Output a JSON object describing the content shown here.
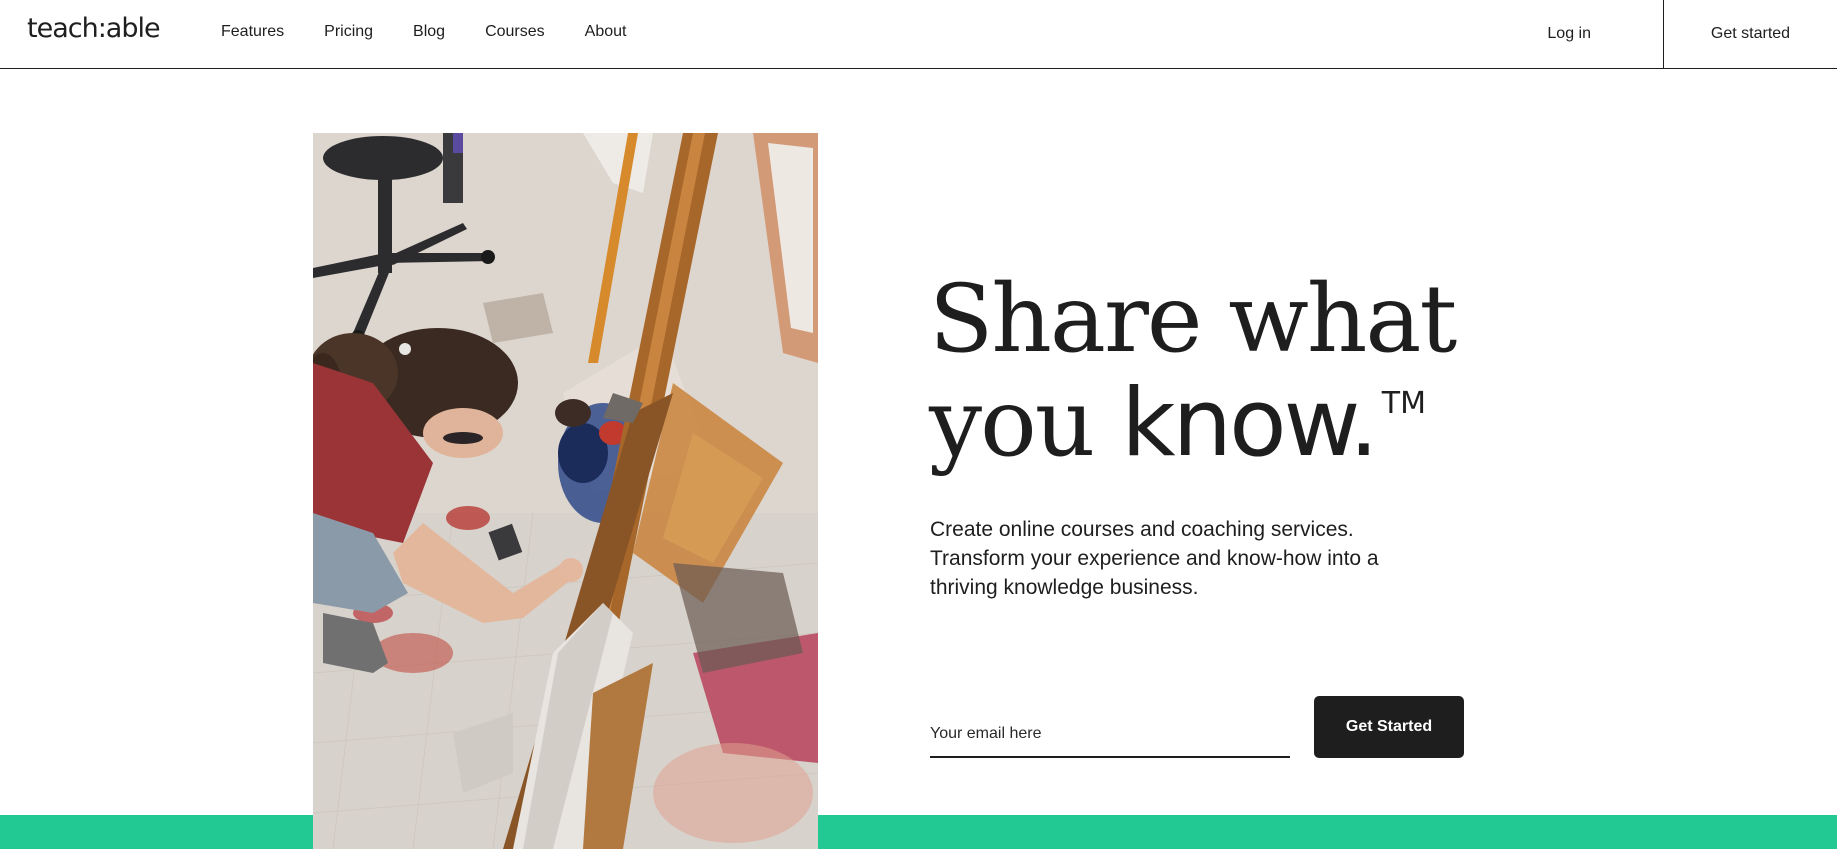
{
  "nav": {
    "logo": "teach:able",
    "links": [
      "Features",
      "Pricing",
      "Blog",
      "Courses",
      "About"
    ],
    "login": "Log in",
    "get_started": "Get started"
  },
  "hero": {
    "headline_line1": "Share what",
    "headline_line2_a": "you ",
    "headline_line2_b": "know.",
    "trademark": "TM",
    "subtext": "Create online courses and coaching services. Transform your experience and know-how into a thriving knowledge business.",
    "email_placeholder": "Your email here",
    "cta": "Get Started"
  },
  "colors": {
    "accent_green": "#22c993",
    "button_dark": "#1e1e1e"
  }
}
